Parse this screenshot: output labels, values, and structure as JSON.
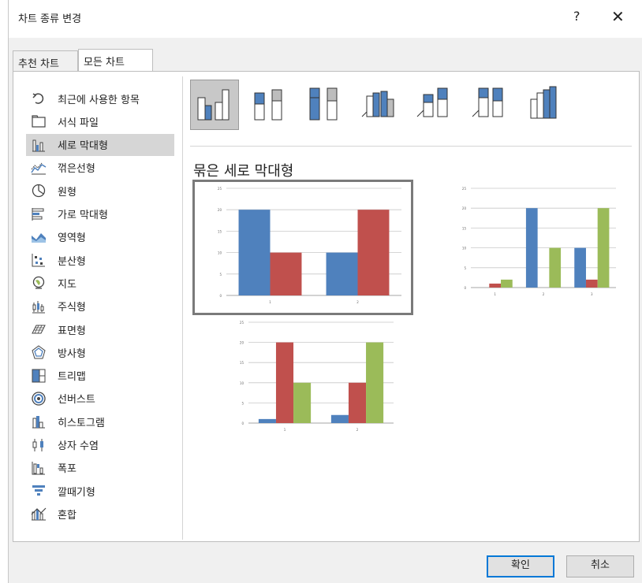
{
  "window": {
    "title": "차트 종류 변경",
    "help_label": "?",
    "close_label": "✕"
  },
  "tabs": [
    {
      "label": "추천 차트",
      "selected": false
    },
    {
      "label": "모든 차트",
      "selected": true
    }
  ],
  "sidebar": {
    "items": [
      {
        "label": "최근에 사용한 항목",
        "icon": "recent-icon"
      },
      {
        "label": "서식 파일",
        "icon": "folder-icon"
      },
      {
        "label": "세로 막대형",
        "icon": "column-chart-icon",
        "selected": true
      },
      {
        "label": "꺾은선형",
        "icon": "line-chart-icon"
      },
      {
        "label": "원형",
        "icon": "pie-chart-icon"
      },
      {
        "label": "가로 막대형",
        "icon": "bar-chart-icon"
      },
      {
        "label": "영역형",
        "icon": "area-chart-icon"
      },
      {
        "label": "분산형",
        "icon": "scatter-chart-icon"
      },
      {
        "label": "지도",
        "icon": "map-chart-icon"
      },
      {
        "label": "주식형",
        "icon": "stock-chart-icon"
      },
      {
        "label": "표면형",
        "icon": "surface-chart-icon"
      },
      {
        "label": "방사형",
        "icon": "radar-chart-icon"
      },
      {
        "label": "트리맵",
        "icon": "treemap-chart-icon"
      },
      {
        "label": "선버스트",
        "icon": "sunburst-chart-icon"
      },
      {
        "label": "히스토그램",
        "icon": "histogram-chart-icon"
      },
      {
        "label": "상자 수염",
        "icon": "box-whisker-chart-icon"
      },
      {
        "label": "폭포",
        "icon": "waterfall-chart-icon"
      },
      {
        "label": "깔때기형",
        "icon": "funnel-chart-icon"
      },
      {
        "label": "혼합",
        "icon": "combo-chart-icon"
      }
    ]
  },
  "subtypes": [
    {
      "name": "clustered-column",
      "selected": true
    },
    {
      "name": "stacked-column",
      "selected": false
    },
    {
      "name": "100-stacked-column",
      "selected": false
    },
    {
      "name": "3d-clustered-column",
      "selected": false
    },
    {
      "name": "3d-stacked-column",
      "selected": false
    },
    {
      "name": "3d-100-stacked-column",
      "selected": false
    },
    {
      "name": "3d-column",
      "selected": false
    }
  ],
  "variant_title": "묶은 세로 막대형",
  "colors": {
    "blue": "#4f81bd",
    "red": "#c0504d",
    "green": "#9bbb59"
  },
  "chart_data": [
    {
      "type": "bar",
      "categories": [
        "1",
        "2"
      ],
      "series": [
        {
          "values": [
            20,
            10
          ]
        },
        {
          "values": [
            10,
            20
          ]
        }
      ],
      "yticks": [
        "0",
        "5",
        "10",
        "15",
        "20",
        "25"
      ],
      "ylim": [
        0,
        25
      ],
      "grid": true,
      "selected": true
    },
    {
      "type": "bar",
      "categories": [
        "1",
        "2",
        "3"
      ],
      "series": [
        {
          "values": [
            0,
            20,
            10
          ]
        },
        {
          "values": [
            1,
            0,
            2
          ]
        },
        {
          "values": [
            2,
            10,
            20
          ]
        }
      ],
      "yticks": [
        "0",
        "5",
        "10",
        "15",
        "20",
        "25"
      ],
      "ylim": [
        0,
        25
      ],
      "grid": true,
      "selected": false
    },
    {
      "type": "bar",
      "categories": [
        "1",
        "2"
      ],
      "series": [
        {
          "values": [
            1,
            2
          ]
        },
        {
          "values": [
            20,
            10
          ]
        },
        {
          "values": [
            10,
            20
          ]
        }
      ],
      "yticks": [
        "0",
        "5",
        "10",
        "15",
        "20",
        "25"
      ],
      "ylim": [
        0,
        25
      ],
      "grid": true,
      "selected": false
    }
  ],
  "footer": {
    "ok_label": "확인",
    "cancel_label": "취소"
  }
}
